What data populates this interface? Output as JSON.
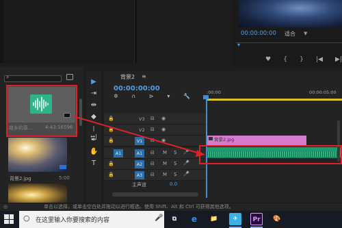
{
  "program_monitor": {
    "timecode": "00:00:00:00",
    "fit_label": "适合",
    "fit_arrow": "▼",
    "controls": [
      "♥",
      "{",
      "}",
      "|◀",
      "▶|"
    ]
  },
  "project": {
    "clips": [
      {
        "name": "故乡的原...",
        "duration": "4:43:16596"
      },
      {
        "name": "背景2.jpg",
        "duration": "5:00"
      }
    ]
  },
  "tools": [
    "▶",
    "⇥",
    "⇹",
    "◆",
    "|↔|",
    "✒",
    "✋",
    "T"
  ],
  "timeline": {
    "tab_label": "背景2",
    "tab_menu": "≡",
    "timecode": "00:00:00:00",
    "icons": [
      "✲",
      "∩",
      "⊳",
      "▾",
      "🔧"
    ],
    "ruler_start": ":00:00",
    "ruler_end": "00:00:05:00",
    "tracks": [
      {
        "name": "V3",
        "type": "video"
      },
      {
        "name": "V2",
        "type": "video"
      },
      {
        "name": "V1",
        "type": "video",
        "source": "V1"
      },
      {
        "name": "A1",
        "type": "audio",
        "source": "A1"
      },
      {
        "name": "A2",
        "type": "audio"
      },
      {
        "name": "A3",
        "type": "audio"
      }
    ],
    "video_clip_name": "背景2.jpg",
    "master_label": "主声道",
    "master_value": "0.0",
    "track_buttons": {
      "lock": "🔒",
      "sync": "⊟",
      "eye": "◉",
      "mute": "M",
      "solo": "S",
      "mic": "🎤"
    }
  },
  "status": {
    "icon": "◎",
    "text": "单击以选择，或单击空白处并拖动以进行框选。使用 Shift、Alt 和 Ctrl 可获得其他选项。"
  },
  "taskbar": {
    "search_placeholder": "在这里输入你要搜索的内容",
    "search_icon": "○",
    "mic_icon": "🎤",
    "apps": [
      {
        "name": "task-view",
        "label": "⧉"
      },
      {
        "name": "edge",
        "label": "e"
      },
      {
        "name": "file-explorer",
        "label": "📁"
      },
      {
        "name": "bird-app",
        "label": "✈"
      },
      {
        "name": "premiere",
        "label": "Pr"
      },
      {
        "name": "paint",
        "label": "🎨"
      }
    ]
  },
  "colors": {
    "accent_blue": "#4f9ee6",
    "annotation_red": "#e0202a",
    "video_clip": "#d77bd0",
    "audio_clip": "#1e9a6f"
  }
}
